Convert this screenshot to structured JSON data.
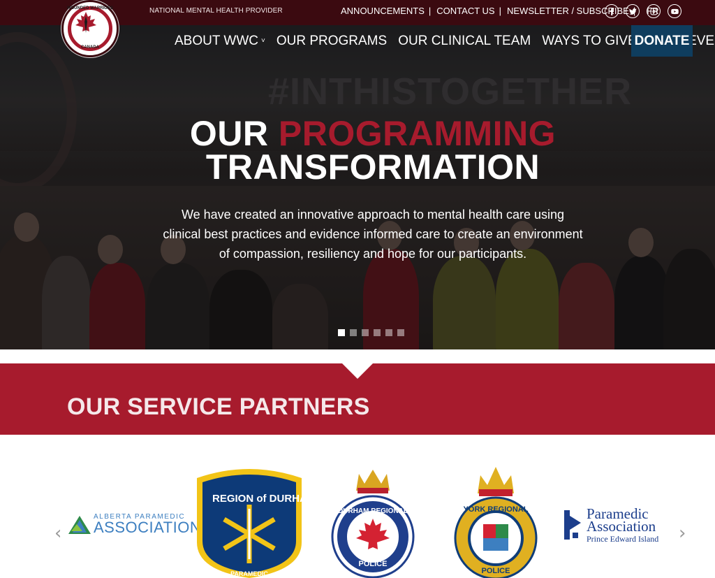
{
  "topbar": {
    "tagline": "NATIONAL MENTAL HEALTH PROVIDER",
    "links": [
      "ANNOUNCEMENTS",
      "CONTACT US",
      "NEWSLETTER / SUBSCRIBE",
      "FR"
    ],
    "separator": "|",
    "socials": [
      "facebook-icon",
      "twitter-icon",
      "instagram-icon",
      "youtube-icon"
    ]
  },
  "logo": {
    "top_text": "WOUNDED WARRIORS",
    "bottom_text": "CANADA"
  },
  "nav": {
    "items": [
      {
        "label": "ABOUT WWC",
        "dropdown": true
      },
      {
        "label": "OUR PROGRAMS",
        "dropdown": false
      },
      {
        "label": "OUR CLINICAL TEAM",
        "dropdown": false
      },
      {
        "label": "WAYS TO GIVE",
        "dropdown": true
      },
      {
        "label": "OUR EVENTS",
        "dropdown": false
      }
    ],
    "chevron": "˅",
    "donate": "DONATE"
  },
  "hero": {
    "background_text": "#INTHISTOGETHER",
    "title_plain": "OUR ",
    "title_highlight": "PROGRAMMING",
    "title_line2": "TRANSFORMATION",
    "body": "We have created an innovative approach to mental health care using clinical best practices and evidence informed care to create an environment of compassion, resiliency and hope for our participants.",
    "slides": 6,
    "active_slide": 1
  },
  "partners": {
    "title": "OUR SERVICE PARTNERS",
    "prev": "‹",
    "next": "›",
    "logos": [
      {
        "top": "ALBERTA PARAMEDIC",
        "main": "ASSOCIATION"
      },
      {
        "arc": "REGION of DURHAM",
        "bottom": "PARAMEDIC"
      },
      {
        "arc_top": "DURHAM REGIONAL",
        "arc_bottom": "POLICE"
      },
      {
        "arc_top": "YORK REGIONAL",
        "arc_bottom": "POLICE"
      },
      {
        "line1": "Paramedic",
        "line2": "Association",
        "line3": "Prince Edward Island"
      }
    ]
  },
  "colors": {
    "topbar": "#3b0a10",
    "brand_red": "#a71b2d",
    "donate_blue": "#0f3d5e"
  }
}
